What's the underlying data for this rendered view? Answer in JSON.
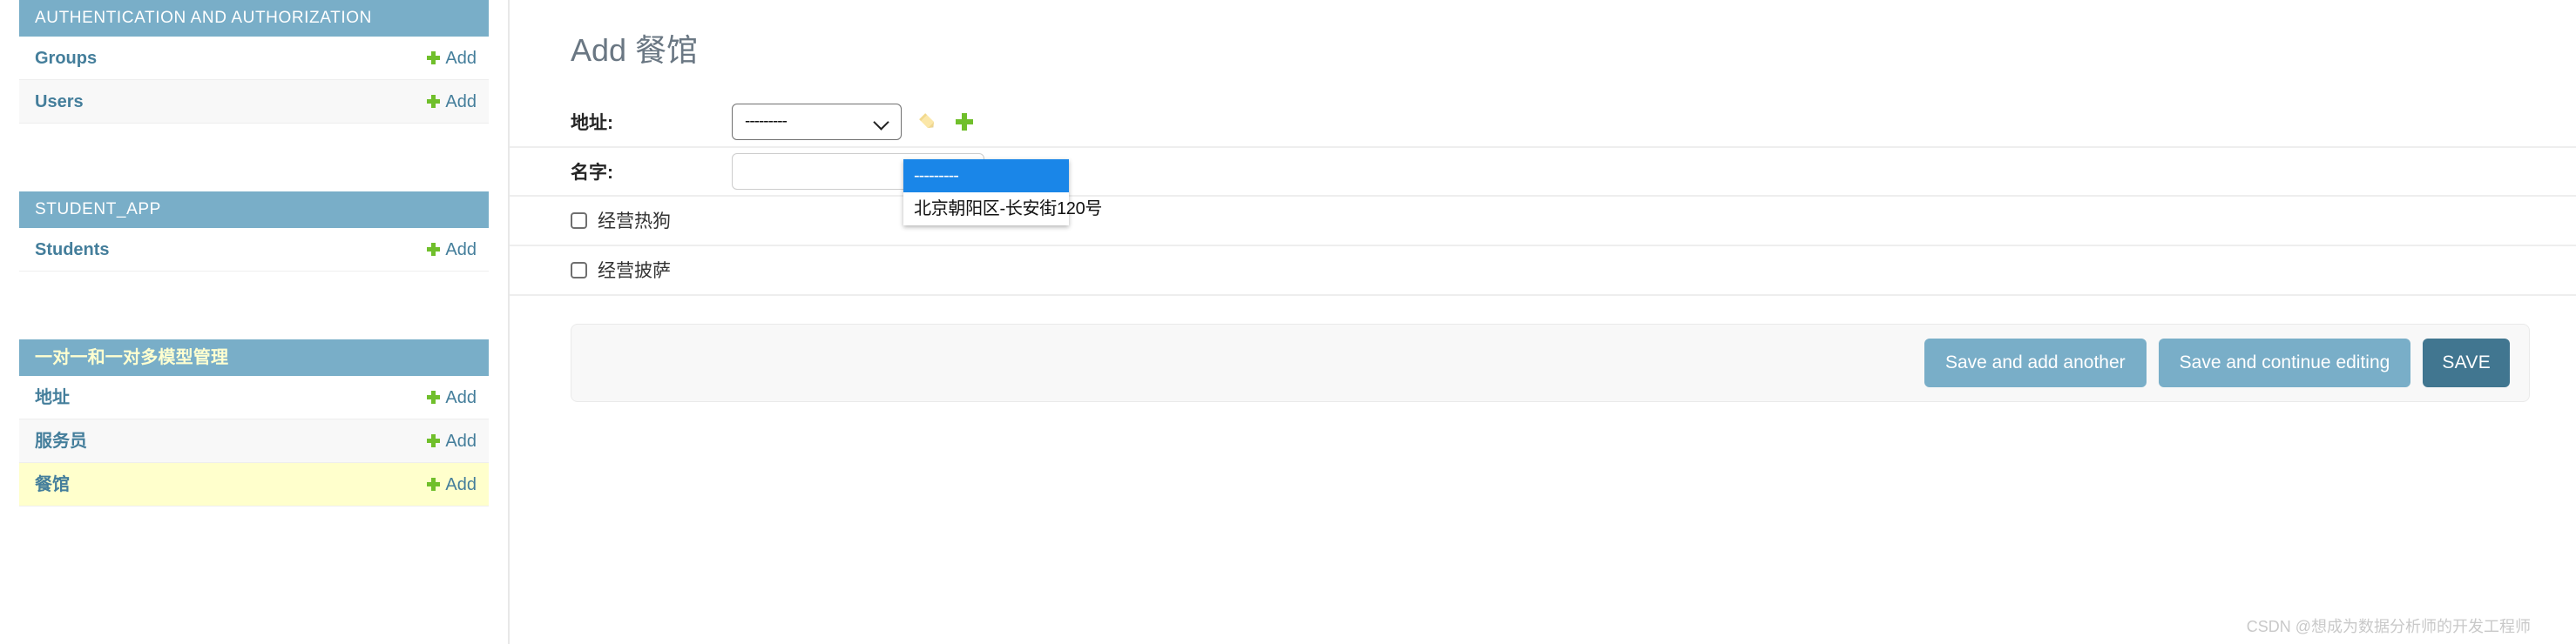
{
  "sidebar": {
    "modules": [
      {
        "caption": "AUTHENTICATION AND AUTHORIZATION",
        "caption_style": "latin",
        "models": [
          {
            "name": "Groups",
            "add_label": "Add",
            "state": "normal"
          },
          {
            "name": "Users",
            "add_label": "Add",
            "state": "alt"
          }
        ]
      },
      {
        "caption": "STUDENT_APP",
        "caption_style": "latin",
        "models": [
          {
            "name": "Students",
            "add_label": "Add",
            "state": "normal"
          }
        ]
      },
      {
        "caption": "一对一和一对多模型管理",
        "caption_style": "cn",
        "models": [
          {
            "name": "地址",
            "add_label": "Add",
            "state": "normal"
          },
          {
            "name": "服务员",
            "add_label": "Add",
            "state": "alt"
          },
          {
            "name": "餐馆",
            "add_label": "Add",
            "state": "current"
          }
        ]
      }
    ]
  },
  "main": {
    "page_title": "Add 餐馆",
    "fields": [
      {
        "label": "地址:",
        "type": "select",
        "value": "---------",
        "related_edit_icon": "pencil-icon",
        "related_add_icon": "plus-icon"
      },
      {
        "label": "名字:",
        "type": "text",
        "value": "",
        "placeholder": ""
      }
    ],
    "dropdown": {
      "open": true,
      "options": [
        {
          "label": "---------",
          "selected": true
        },
        {
          "label": "北京朝阳区-长安街120号",
          "selected": false
        }
      ]
    },
    "checkboxes": [
      {
        "label": "经营热狗",
        "checked": false
      },
      {
        "label": "经营披萨",
        "checked": false
      }
    ],
    "submit_row": {
      "save_and_add_another": "Save and add another",
      "save_and_continue": "Save and continue editing",
      "save": "SAVE"
    }
  },
  "watermark": "CSDN @想成为数据分析师的开发工程师",
  "colors": {
    "header_blue": "#79aec8",
    "link_blue": "#447e9b",
    "add_green": "#70bf2b",
    "current_highlight": "#ffffcc",
    "save_dark": "#417690",
    "option_selected": "#1a86e8",
    "title_gray": "#6a7783"
  }
}
